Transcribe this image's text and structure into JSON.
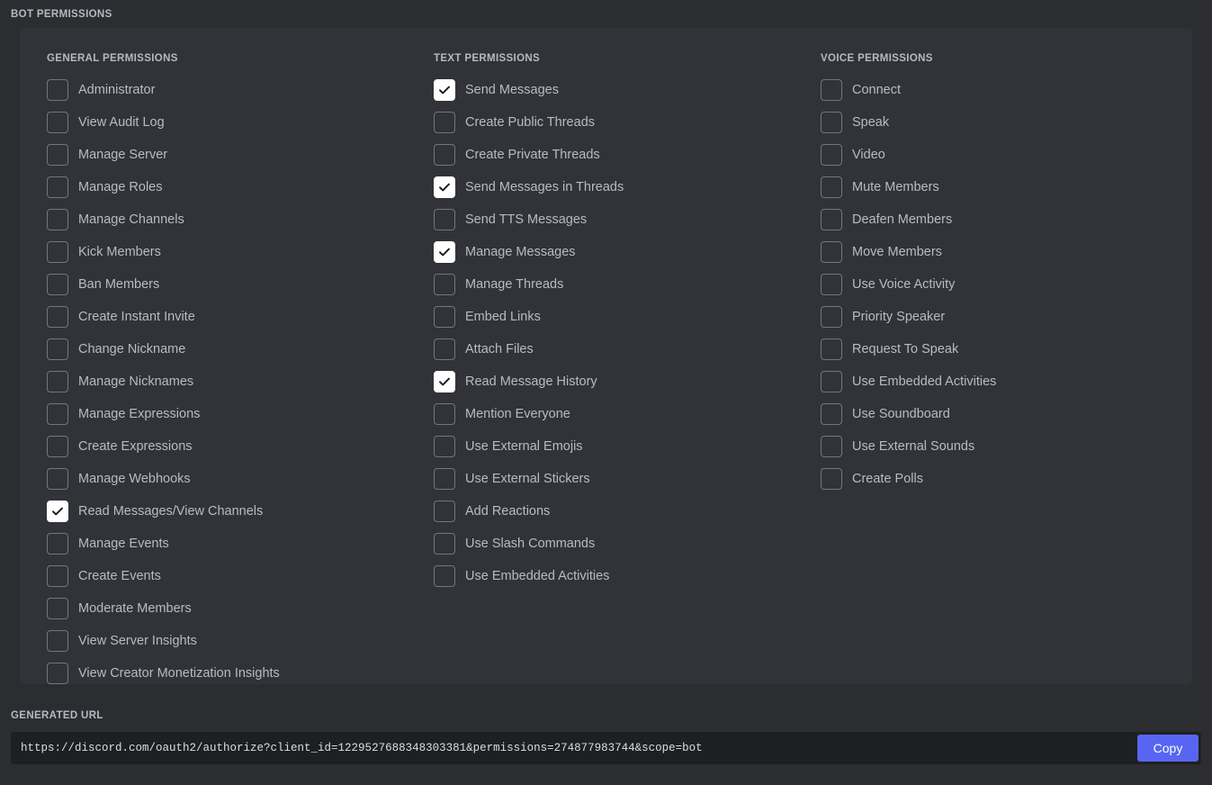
{
  "header": {
    "title": "Bot Permissions"
  },
  "columns": [
    {
      "id": "general",
      "header": "General Permissions",
      "permissions": [
        {
          "label": "Administrator",
          "checked": false
        },
        {
          "label": "View Audit Log",
          "checked": false
        },
        {
          "label": "Manage Server",
          "checked": false
        },
        {
          "label": "Manage Roles",
          "checked": false
        },
        {
          "label": "Manage Channels",
          "checked": false
        },
        {
          "label": "Kick Members",
          "checked": false
        },
        {
          "label": "Ban Members",
          "checked": false
        },
        {
          "label": "Create Instant Invite",
          "checked": false
        },
        {
          "label": "Change Nickname",
          "checked": false
        },
        {
          "label": "Manage Nicknames",
          "checked": false
        },
        {
          "label": "Manage Expressions",
          "checked": false
        },
        {
          "label": "Create Expressions",
          "checked": false
        },
        {
          "label": "Manage Webhooks",
          "checked": false
        },
        {
          "label": "Read Messages/View Channels",
          "checked": true
        },
        {
          "label": "Manage Events",
          "checked": false
        },
        {
          "label": "Create Events",
          "checked": false
        },
        {
          "label": "Moderate Members",
          "checked": false
        },
        {
          "label": "View Server Insights",
          "checked": false
        },
        {
          "label": "View Creator Monetization Insights",
          "checked": false
        }
      ]
    },
    {
      "id": "text",
      "header": "Text Permissions",
      "permissions": [
        {
          "label": "Send Messages",
          "checked": true
        },
        {
          "label": "Create Public Threads",
          "checked": false
        },
        {
          "label": "Create Private Threads",
          "checked": false
        },
        {
          "label": "Send Messages in Threads",
          "checked": true
        },
        {
          "label": "Send TTS Messages",
          "checked": false
        },
        {
          "label": "Manage Messages",
          "checked": true
        },
        {
          "label": "Manage Threads",
          "checked": false
        },
        {
          "label": "Embed Links",
          "checked": false
        },
        {
          "label": "Attach Files",
          "checked": false
        },
        {
          "label": "Read Message History",
          "checked": true
        },
        {
          "label": "Mention Everyone",
          "checked": false
        },
        {
          "label": "Use External Emojis",
          "checked": false
        },
        {
          "label": "Use External Stickers",
          "checked": false
        },
        {
          "label": "Add Reactions",
          "checked": false
        },
        {
          "label": "Use Slash Commands",
          "checked": false
        },
        {
          "label": "Use Embedded Activities",
          "checked": false
        }
      ]
    },
    {
      "id": "voice",
      "header": "Voice Permissions",
      "permissions": [
        {
          "label": "Connect",
          "checked": false
        },
        {
          "label": "Speak",
          "checked": false
        },
        {
          "label": "Video",
          "checked": false
        },
        {
          "label": "Mute Members",
          "checked": false
        },
        {
          "label": "Deafen Members",
          "checked": false
        },
        {
          "label": "Move Members",
          "checked": false
        },
        {
          "label": "Use Voice Activity",
          "checked": false
        },
        {
          "label": "Priority Speaker",
          "checked": false
        },
        {
          "label": "Request To Speak",
          "checked": false
        },
        {
          "label": "Use Embedded Activities",
          "checked": false
        },
        {
          "label": "Use Soundboard",
          "checked": false
        },
        {
          "label": "Use External Sounds",
          "checked": false
        },
        {
          "label": "Create Polls",
          "checked": false
        }
      ]
    }
  ],
  "generated_url": {
    "label": "Generated URL",
    "value": "https://discord.com/oauth2/authorize?client_id=1229527688348303381&permissions=274877983744&scope=bot",
    "copy_label": "Copy"
  },
  "colors": {
    "page_background": "#2b2d31",
    "card_background": "#313338",
    "input_background": "#1e1f22",
    "accent_blurple": "#5865f2",
    "label_text": "#b5bac1",
    "permission_text": "#b9bbbe",
    "checkbox_border": "#72767d",
    "checkbox_checked_fill": "#ffffff"
  }
}
